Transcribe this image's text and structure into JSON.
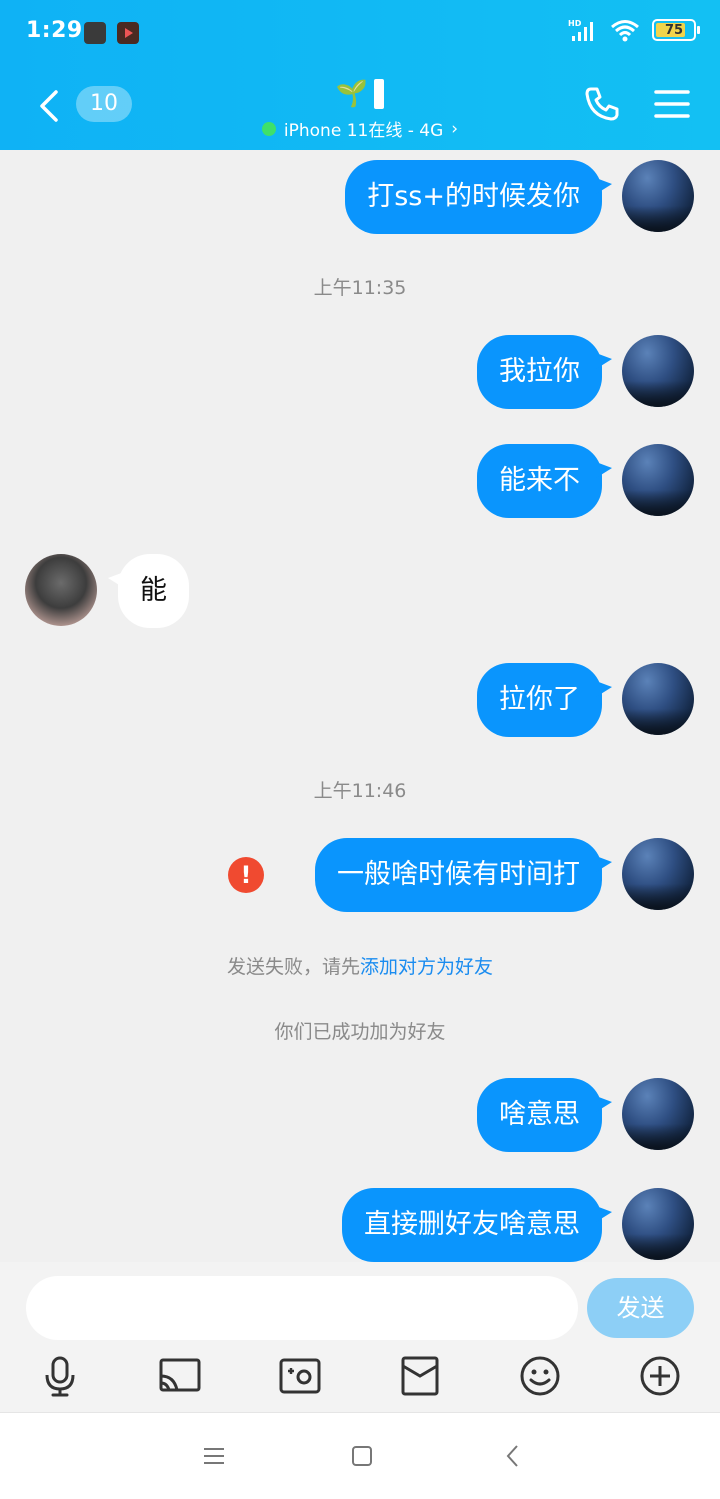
{
  "status_bar": {
    "time": "1:29",
    "battery": "75",
    "network_badge": "HD"
  },
  "header": {
    "unread_count": "10",
    "contact_name_emoji": "🌱",
    "presence_text": "iPhone 11在线 - 4G",
    "chevron": "›"
  },
  "messages": {
    "m1": "打ss+的时候发你",
    "t1": "上午11:35",
    "m2": "我拉你",
    "m3": "能来不",
    "m4": "能",
    "m5": "拉你了",
    "t2": "上午11:46",
    "m6": "一般啥时候有时间打",
    "fail_prefix": "发送失败，请先",
    "fail_link": "添加对方为好友",
    "friend_added": "你们已成功加为好友",
    "m7": "啥意思",
    "m8": "直接删好友啥意思"
  },
  "composer": {
    "value": "",
    "send_label": "发送"
  },
  "colors": {
    "header": "#0fb2f5",
    "my_bubble": "#0a95fd",
    "send_button": "#8dcff6",
    "error": "#f04a30",
    "link": "#1a8cf0"
  },
  "icons": [
    "back-icon",
    "phone-icon",
    "menu-icon",
    "mic-icon",
    "screen-share-icon",
    "photo-icon",
    "red-packet-icon",
    "emoji-icon",
    "plus-icon"
  ]
}
